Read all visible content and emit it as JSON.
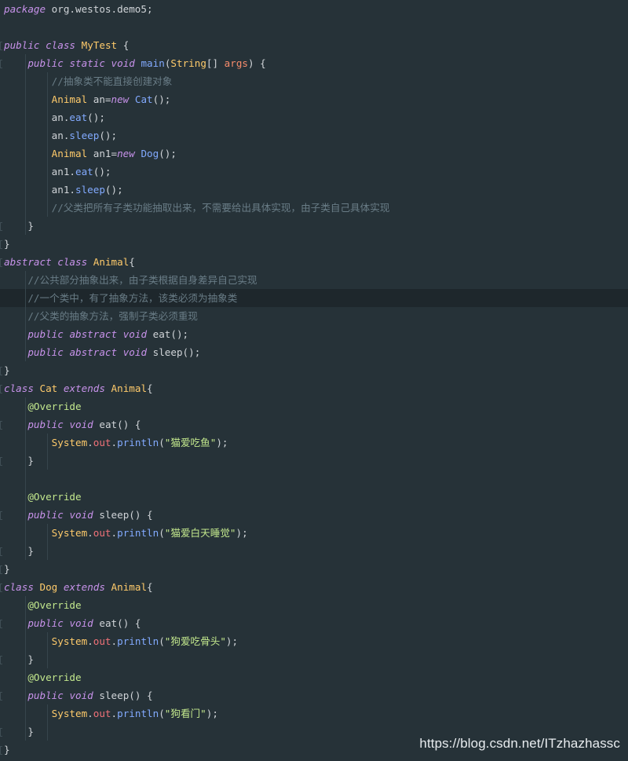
{
  "editor": {
    "lines": [
      [
        [
          "kw",
          "package"
        ],
        [
          "pl",
          " org.westos.demo5;"
        ]
      ],
      [],
      [
        [
          "kw",
          "public"
        ],
        [
          "pl",
          " "
        ],
        [
          "kw",
          "class"
        ],
        [
          "pl",
          " "
        ],
        [
          "cls",
          "MyTest"
        ],
        [
          "pl",
          " {"
        ]
      ],
      [
        [
          "pl",
          "    "
        ],
        [
          "kw",
          "public"
        ],
        [
          "pl",
          " "
        ],
        [
          "kw",
          "static"
        ],
        [
          "pl",
          " "
        ],
        [
          "kw",
          "void"
        ],
        [
          "pl",
          " "
        ],
        [
          "fn",
          "main"
        ],
        [
          "pl",
          "("
        ],
        [
          "ty",
          "String"
        ],
        [
          "pl",
          "[] "
        ],
        [
          "pa",
          "args"
        ],
        [
          "pl",
          ") {"
        ]
      ],
      [
        [
          "pl",
          "        "
        ],
        [
          "cm",
          "//抽象类不能直接创建对象"
        ]
      ],
      [
        [
          "pl",
          "        "
        ],
        [
          "ty",
          "Animal"
        ],
        [
          "pl",
          " an="
        ],
        [
          "kw",
          "new"
        ],
        [
          "pl",
          " "
        ],
        [
          "fn",
          "Cat"
        ],
        [
          "pl",
          "();"
        ]
      ],
      [
        [
          "pl",
          "        an."
        ],
        [
          "fn",
          "eat"
        ],
        [
          "pl",
          "();"
        ]
      ],
      [
        [
          "pl",
          "        an."
        ],
        [
          "fn",
          "sleep"
        ],
        [
          "pl",
          "();"
        ]
      ],
      [
        [
          "pl",
          "        "
        ],
        [
          "ty",
          "Animal"
        ],
        [
          "pl",
          " an1="
        ],
        [
          "kw",
          "new"
        ],
        [
          "pl",
          " "
        ],
        [
          "fn",
          "Dog"
        ],
        [
          "pl",
          "();"
        ]
      ],
      [
        [
          "pl",
          "        an1."
        ],
        [
          "fn",
          "eat"
        ],
        [
          "pl",
          "();"
        ]
      ],
      [
        [
          "pl",
          "        an1."
        ],
        [
          "fn",
          "sleep"
        ],
        [
          "pl",
          "();"
        ]
      ],
      [
        [
          "pl",
          "        "
        ],
        [
          "cm",
          "//父类把所有子类功能抽取出来，不需要给出具体实现，由子类自己具体实现"
        ]
      ],
      [
        [
          "pl",
          "    }"
        ]
      ],
      [
        [
          "pl",
          "}"
        ]
      ],
      [
        [
          "kw",
          "abstract"
        ],
        [
          "pl",
          " "
        ],
        [
          "kw",
          "class"
        ],
        [
          "pl",
          " "
        ],
        [
          "cls",
          "Animal"
        ],
        [
          "pl",
          "{"
        ]
      ],
      [
        [
          "pl",
          "    "
        ],
        [
          "cm",
          "//公共部分抽象出来，由子类根据自身差异自己实现"
        ]
      ],
      [
        [
          "pl",
          "    "
        ],
        [
          "cm",
          "//一个类中，有了抽象方法，该类必须为抽象类"
        ]
      ],
      [
        [
          "pl",
          "    "
        ],
        [
          "cm",
          "//父类的抽象方法，强制子类必须重现"
        ]
      ],
      [
        [
          "pl",
          "    "
        ],
        [
          "kw",
          "public"
        ],
        [
          "pl",
          " "
        ],
        [
          "kw",
          "abstract"
        ],
        [
          "pl",
          " "
        ],
        [
          "kw",
          "void"
        ],
        [
          "pl",
          " eat();"
        ]
      ],
      [
        [
          "pl",
          "    "
        ],
        [
          "kw",
          "public"
        ],
        [
          "pl",
          " "
        ],
        [
          "kw",
          "abstract"
        ],
        [
          "pl",
          " "
        ],
        [
          "kw",
          "void"
        ],
        [
          "pl",
          " sleep();"
        ]
      ],
      [
        [
          "pl",
          "}"
        ]
      ],
      [
        [
          "kw",
          "class"
        ],
        [
          "pl",
          " "
        ],
        [
          "cls",
          "Cat"
        ],
        [
          "pl",
          " "
        ],
        [
          "kw",
          "extends"
        ],
        [
          "pl",
          " "
        ],
        [
          "cls",
          "Animal"
        ],
        [
          "pl",
          "{"
        ]
      ],
      [
        [
          "pl",
          "    "
        ],
        [
          "an",
          "@Override"
        ]
      ],
      [
        [
          "pl",
          "    "
        ],
        [
          "kw",
          "public"
        ],
        [
          "pl",
          " "
        ],
        [
          "kw",
          "void"
        ],
        [
          "pl",
          " eat() {"
        ]
      ],
      [
        [
          "pl",
          "        "
        ],
        [
          "ty",
          "System"
        ],
        [
          "pl",
          "."
        ],
        [
          "fd",
          "out"
        ],
        [
          "pl",
          "."
        ],
        [
          "fn",
          "println"
        ],
        [
          "pl",
          "("
        ],
        [
          "st",
          "\"猫爱吃鱼\""
        ],
        [
          "pl",
          ");"
        ]
      ],
      [
        [
          "pl",
          "    }"
        ]
      ],
      [],
      [
        [
          "pl",
          "    "
        ],
        [
          "an",
          "@Override"
        ]
      ],
      [
        [
          "pl",
          "    "
        ],
        [
          "kw",
          "public"
        ],
        [
          "pl",
          " "
        ],
        [
          "kw",
          "void"
        ],
        [
          "pl",
          " sleep() {"
        ]
      ],
      [
        [
          "pl",
          "        "
        ],
        [
          "ty",
          "System"
        ],
        [
          "pl",
          "."
        ],
        [
          "fd",
          "out"
        ],
        [
          "pl",
          "."
        ],
        [
          "fn",
          "println"
        ],
        [
          "pl",
          "("
        ],
        [
          "st",
          "\"猫爱白天睡觉\""
        ],
        [
          "pl",
          ");"
        ]
      ],
      [
        [
          "pl",
          "    }"
        ]
      ],
      [
        [
          "pl",
          "}"
        ]
      ],
      [
        [
          "kw",
          "class"
        ],
        [
          "pl",
          " "
        ],
        [
          "cls",
          "Dog"
        ],
        [
          "pl",
          " "
        ],
        [
          "kw",
          "extends"
        ],
        [
          "pl",
          " "
        ],
        [
          "cls",
          "Animal"
        ],
        [
          "pl",
          "{"
        ]
      ],
      [
        [
          "pl",
          "    "
        ],
        [
          "an",
          "@Override"
        ]
      ],
      [
        [
          "pl",
          "    "
        ],
        [
          "kw",
          "public"
        ],
        [
          "pl",
          " "
        ],
        [
          "kw",
          "void"
        ],
        [
          "pl",
          " eat() {"
        ]
      ],
      [
        [
          "pl",
          "        "
        ],
        [
          "ty",
          "System"
        ],
        [
          "pl",
          "."
        ],
        [
          "fd",
          "out"
        ],
        [
          "pl",
          "."
        ],
        [
          "fn",
          "println"
        ],
        [
          "pl",
          "("
        ],
        [
          "st",
          "\"狗爱吃骨头\""
        ],
        [
          "pl",
          ");"
        ]
      ],
      [
        [
          "pl",
          "    }"
        ]
      ],
      [
        [
          "pl",
          "    "
        ],
        [
          "an",
          "@Override"
        ]
      ],
      [
        [
          "pl",
          "    "
        ],
        [
          "kw",
          "public"
        ],
        [
          "pl",
          " "
        ],
        [
          "kw",
          "void"
        ],
        [
          "pl",
          " sleep() {"
        ]
      ],
      [
        [
          "pl",
          "        "
        ],
        [
          "ty",
          "System"
        ],
        [
          "pl",
          "."
        ],
        [
          "fd",
          "out"
        ],
        [
          "pl",
          "."
        ],
        [
          "fn",
          "println"
        ],
        [
          "pl",
          "("
        ],
        [
          "st",
          "\"狗看门\""
        ],
        [
          "pl",
          ");"
        ]
      ],
      [
        [
          "pl",
          "    }"
        ]
      ],
      [
        [
          "pl",
          "}"
        ]
      ]
    ],
    "highlighted_line": 16,
    "fold_markers": [
      2,
      3,
      12,
      13,
      14,
      20,
      21,
      23,
      25,
      28,
      30,
      31,
      32,
      34,
      36,
      38,
      40,
      41
    ]
  },
  "watermark": "https://blog.csdn.net/ITzhazhassc"
}
